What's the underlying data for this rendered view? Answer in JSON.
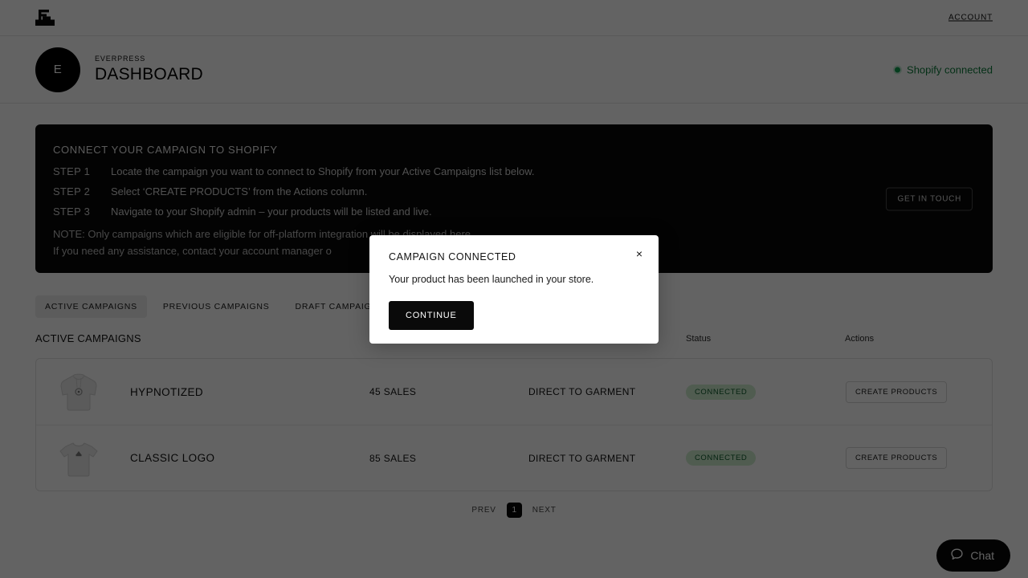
{
  "topbar": {
    "logo_icon": "everpress-logo-icon",
    "account_label": "ACCOUNT"
  },
  "header": {
    "avatar_initial": "E",
    "brand_label": "EVERPRESS",
    "title": "DASHBOARD",
    "shopify_status": "Shopify connected",
    "status_dot_icon": "status-dot-icon",
    "status_color": "#0f9d4f"
  },
  "banner": {
    "title": "CONNECT YOUR CAMPAIGN TO SHOPIFY",
    "steps": [
      {
        "key": "STEP 1",
        "text": "Locate the campaign you want to connect to Shopify from your Active Campaigns list below."
      },
      {
        "key": "STEP 2",
        "text": "Select ‘CREATE PRODUCTS’ from the Actions column."
      },
      {
        "key": "STEP 3",
        "text": "Navigate to your Shopify admin – your products will be listed and live."
      }
    ],
    "note_line_1": "NOTE: Only campaigns which are eligible for off-platform integration will be displayed here.",
    "note_line_2": "If you need any assistance, contact your account manager o",
    "get_in_touch_label": "GET IN TOUCH"
  },
  "tabs": [
    {
      "label": "ACTIVE CAMPAIGNS",
      "active": true
    },
    {
      "label": "PREVIOUS CAMPAIGNS",
      "active": false
    },
    {
      "label": "DRAFT CAMPAIGNS",
      "active": false
    }
  ],
  "table": {
    "section_title": "ACTIVE CAMPAIGNS",
    "columns": {
      "status": "Status",
      "actions": "Actions"
    },
    "rows": [
      {
        "thumb_icon": "hoodie-thumbnail-icon",
        "name": "HYPNOTIZED",
        "sales": "45 SALES",
        "method": "DIRECT TO GARMENT",
        "status": "CONNECTED",
        "action_label": "CREATE PRODUCTS"
      },
      {
        "thumb_icon": "tshirt-thumbnail-icon",
        "name": "CLASSIC LOGO",
        "sales": "85 SALES",
        "method": "DIRECT TO GARMENT",
        "status": "CONNECTED",
        "action_label": "CREATE PRODUCTS"
      }
    ]
  },
  "pagination": {
    "prev_label": "PREV",
    "current_page": "1",
    "next_label": "NEXT"
  },
  "chat": {
    "label": "Chat",
    "icon": "chat-bubble-icon"
  },
  "modal": {
    "title": "CAMPAIGN CONNECTED",
    "body": "Your product has been launched in your store.",
    "continue_label": "CONTINUE",
    "close_icon": "close-icon",
    "close_glyph": "×"
  }
}
